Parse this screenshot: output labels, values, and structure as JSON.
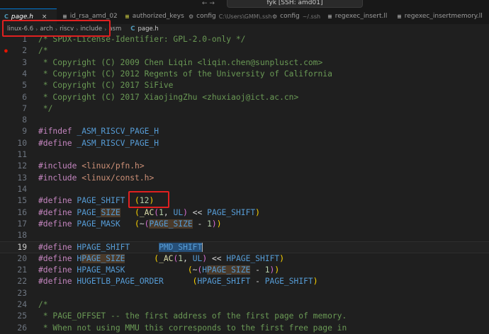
{
  "window": {
    "search_text": "fyk [SSH: amd01]"
  },
  "tabs": [
    {
      "icon": "C",
      "label": "page.h",
      "desc": "",
      "active": true,
      "close": "×"
    },
    {
      "icon": "≡",
      "label": "id_rsa_amd_02",
      "desc": "",
      "active": false
    },
    {
      "icon": "≡",
      "label": "authorized_keys",
      "desc": "",
      "active": false
    },
    {
      "icon": "⚙",
      "label": "config",
      "desc": "C:\\Users\\GMM\\.ssh",
      "active": false
    },
    {
      "icon": "⚙",
      "label": "config",
      "desc": "~/.ssh",
      "active": false
    },
    {
      "icon": "≡",
      "label": "regexec_insert.ll",
      "desc": "",
      "active": false
    },
    {
      "icon": "≡",
      "label": "regexec_insertmemory.ll",
      "desc": "",
      "active": false
    }
  ],
  "breadcrumb": {
    "items": [
      "linux-6.6",
      "arch",
      "riscv",
      "include",
      "asm"
    ],
    "file_icon": "C",
    "file": "page.h",
    "separator": "›"
  },
  "editor": {
    "current_line": 19,
    "lines": [
      {
        "n": "1",
        "segs": [
          [
            "c",
            "/* SPDX-License-Identifier: GPL-2.0-only */"
          ]
        ]
      },
      {
        "n": "2",
        "segs": [
          [
            "c",
            "/*"
          ]
        ]
      },
      {
        "n": "3",
        "segs": [
          [
            "c",
            " * Copyright (C) 2009 Chen Liqin <liqin.chen@sunplusct.com>"
          ]
        ]
      },
      {
        "n": "4",
        "segs": [
          [
            "c",
            " * Copyright (C) 2012 Regents of the University of California"
          ]
        ]
      },
      {
        "n": "5",
        "segs": [
          [
            "c",
            " * Copyright (C) 2017 SiFive"
          ]
        ]
      },
      {
        "n": "6",
        "segs": [
          [
            "c",
            " * Copyright (C) 2017 XiaojingZhu <zhuxiaoj@ict.ac.cn>"
          ]
        ]
      },
      {
        "n": "7",
        "segs": [
          [
            "c",
            " */"
          ]
        ]
      },
      {
        "n": "8",
        "segs": []
      },
      {
        "n": "9",
        "segs": [
          [
            "p",
            "#ifndef"
          ],
          [
            "w",
            " "
          ],
          [
            "m",
            "_ASM_RISCV_PAGE_H"
          ]
        ]
      },
      {
        "n": "10",
        "segs": [
          [
            "p",
            "#define"
          ],
          [
            "w",
            " "
          ],
          [
            "m",
            "_ASM_RISCV_PAGE_H"
          ]
        ]
      },
      {
        "n": "11",
        "segs": []
      },
      {
        "n": "12",
        "segs": [
          [
            "p",
            "#include"
          ],
          [
            "w",
            " "
          ],
          [
            "s",
            "<linux/pfn.h>"
          ]
        ]
      },
      {
        "n": "13",
        "segs": [
          [
            "p",
            "#include"
          ],
          [
            "w",
            " "
          ],
          [
            "s",
            "<linux/const.h>"
          ]
        ]
      },
      {
        "n": "14",
        "segs": []
      },
      {
        "n": "15",
        "segs": [
          [
            "p",
            "#define"
          ],
          [
            "w",
            " "
          ],
          [
            "m",
            "PAGE_SHIFT"
          ],
          [
            "w",
            "  "
          ],
          [
            "pr",
            "("
          ],
          [
            "n",
            "12"
          ],
          [
            "pr",
            ")"
          ]
        ]
      },
      {
        "n": "16",
        "segs": [
          [
            "p",
            "#define"
          ],
          [
            "w",
            " "
          ],
          [
            "m",
            "PAGE_"
          ],
          [
            "m hl",
            "SIZE"
          ],
          [
            "w",
            "   "
          ],
          [
            "pr",
            "("
          ],
          [
            "f",
            "_AC"
          ],
          [
            "pp",
            "("
          ],
          [
            "n",
            "1"
          ],
          [
            "w",
            ", "
          ],
          [
            "m",
            "UL"
          ],
          [
            "pp",
            ")"
          ],
          [
            "w",
            " << "
          ],
          [
            "m",
            "PAGE_SHIFT"
          ],
          [
            "pr",
            ")"
          ]
        ]
      },
      {
        "n": "17",
        "segs": [
          [
            "p",
            "#define"
          ],
          [
            "w",
            " "
          ],
          [
            "m",
            "PAGE_MASK"
          ],
          [
            "w",
            "   "
          ],
          [
            "pr",
            "("
          ],
          [
            "w",
            "~"
          ],
          [
            "pp",
            "("
          ],
          [
            "m hl",
            "PAGE_SIZE"
          ],
          [
            "w",
            " - "
          ],
          [
            "n",
            "1"
          ],
          [
            "pp",
            ")"
          ],
          [
            "pr",
            ")"
          ]
        ]
      },
      {
        "n": "18",
        "segs": []
      },
      {
        "n": "19",
        "segs": [
          [
            "p",
            "#define"
          ],
          [
            "w",
            " "
          ],
          [
            "m",
            "HPAGE_SHIFT"
          ],
          [
            "w",
            "      "
          ],
          [
            "m sel cursor",
            "PMD_SHIFT"
          ]
        ]
      },
      {
        "n": "20",
        "segs": [
          [
            "p",
            "#define"
          ],
          [
            "w",
            " "
          ],
          [
            "m",
            "H"
          ],
          [
            "m hl",
            "PAGE_SIZE"
          ],
          [
            "w",
            "      "
          ],
          [
            "pr",
            "("
          ],
          [
            "f",
            "_AC"
          ],
          [
            "pp",
            "("
          ],
          [
            "n",
            "1"
          ],
          [
            "w",
            ", "
          ],
          [
            "m",
            "UL"
          ],
          [
            "pp",
            ")"
          ],
          [
            "w",
            " << "
          ],
          [
            "m",
            "HPAGE_SHIFT"
          ],
          [
            "pr",
            ")"
          ]
        ]
      },
      {
        "n": "21",
        "segs": [
          [
            "p",
            "#define"
          ],
          [
            "w",
            " "
          ],
          [
            "m",
            "HPAGE_MASK"
          ],
          [
            "w",
            "             "
          ],
          [
            "pr",
            "("
          ],
          [
            "w",
            "~"
          ],
          [
            "pp",
            "("
          ],
          [
            "m",
            "H"
          ],
          [
            "m hl",
            "PAGE_SIZE"
          ],
          [
            "w",
            " - "
          ],
          [
            "n",
            "1"
          ],
          [
            "pp",
            ")"
          ],
          [
            "pr",
            ")"
          ]
        ]
      },
      {
        "n": "22",
        "segs": [
          [
            "p",
            "#define"
          ],
          [
            "w",
            " "
          ],
          [
            "m",
            "HUGETLB_PAGE_ORDER"
          ],
          [
            "w",
            "      "
          ],
          [
            "pr",
            "("
          ],
          [
            "m",
            "HPAGE_SHIFT"
          ],
          [
            "w",
            " - "
          ],
          [
            "m",
            "PAGE_SHIFT"
          ],
          [
            "pr",
            ")"
          ]
        ]
      },
      {
        "n": "23",
        "segs": []
      },
      {
        "n": "24",
        "segs": [
          [
            "c",
            "/*"
          ]
        ]
      },
      {
        "n": "25",
        "segs": [
          [
            "c",
            " * PAGE_OFFSET -- the first address of the first page of memory."
          ]
        ]
      },
      {
        "n": "26",
        "segs": [
          [
            "c",
            " * When not using MMU this corresponds to the first free page in"
          ]
        ]
      }
    ]
  }
}
